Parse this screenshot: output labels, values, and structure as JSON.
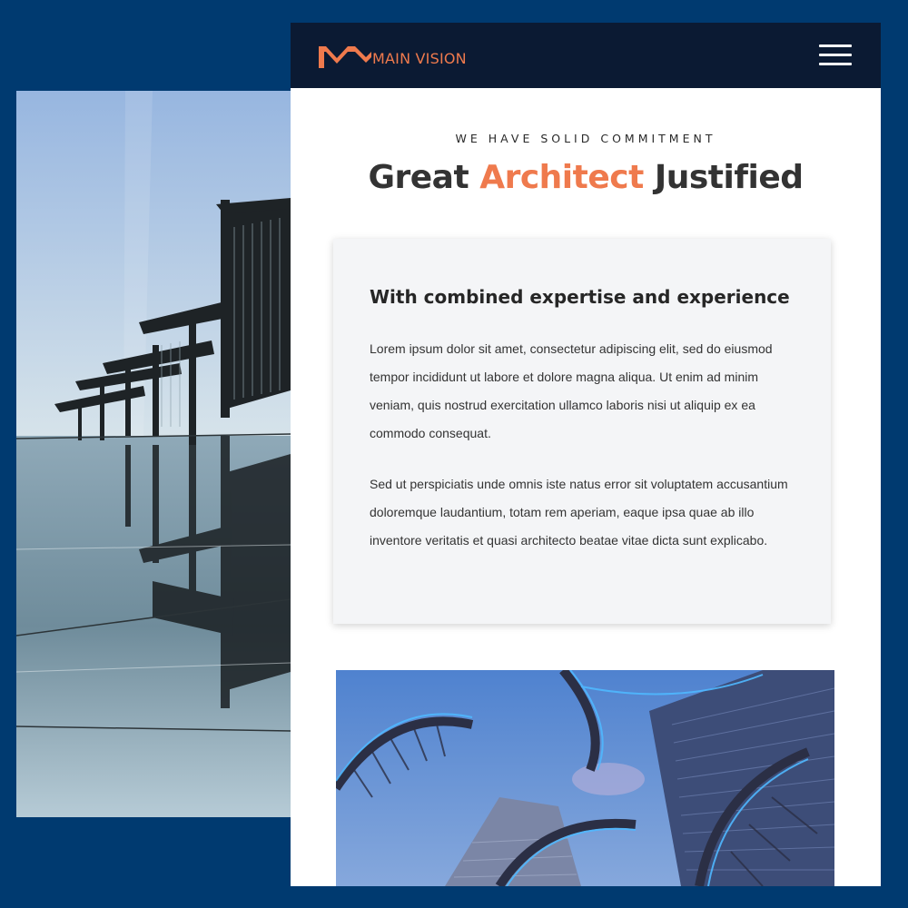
{
  "brand": {
    "name": "MAIN VISION",
    "accent_color": "#ef7a4d",
    "topbar_color": "#0b1a33",
    "background_color": "#003a70"
  },
  "header": {
    "menu_icon": "hamburger-menu-icon"
  },
  "hero": {
    "eyebrow": "WE HAVE SOLID COMMITMENT",
    "title_part1": "Great ",
    "title_accent": "Architect",
    "title_part2": " Justified"
  },
  "card": {
    "title": "With combined expertise and experience",
    "paragraph1": "Lorem ipsum dolor sit amet, consectetur adipiscing elit, sed do eiusmod tempor incididunt ut labore et dolore magna aliqua. Ut enim ad minim veniam, quis nostrud exercitation ullamco laboris nisi ut aliquip ex ea commodo consequat.",
    "paragraph2": "Sed ut perspiciatis unde omnis iste natus error sit voluptatem accusantium doloremque laudantium, totam rem aperiam, eaque ipsa quae ab illo inventore veritatis et quasi architecto beatae vitae dicta sunt explicabo."
  }
}
